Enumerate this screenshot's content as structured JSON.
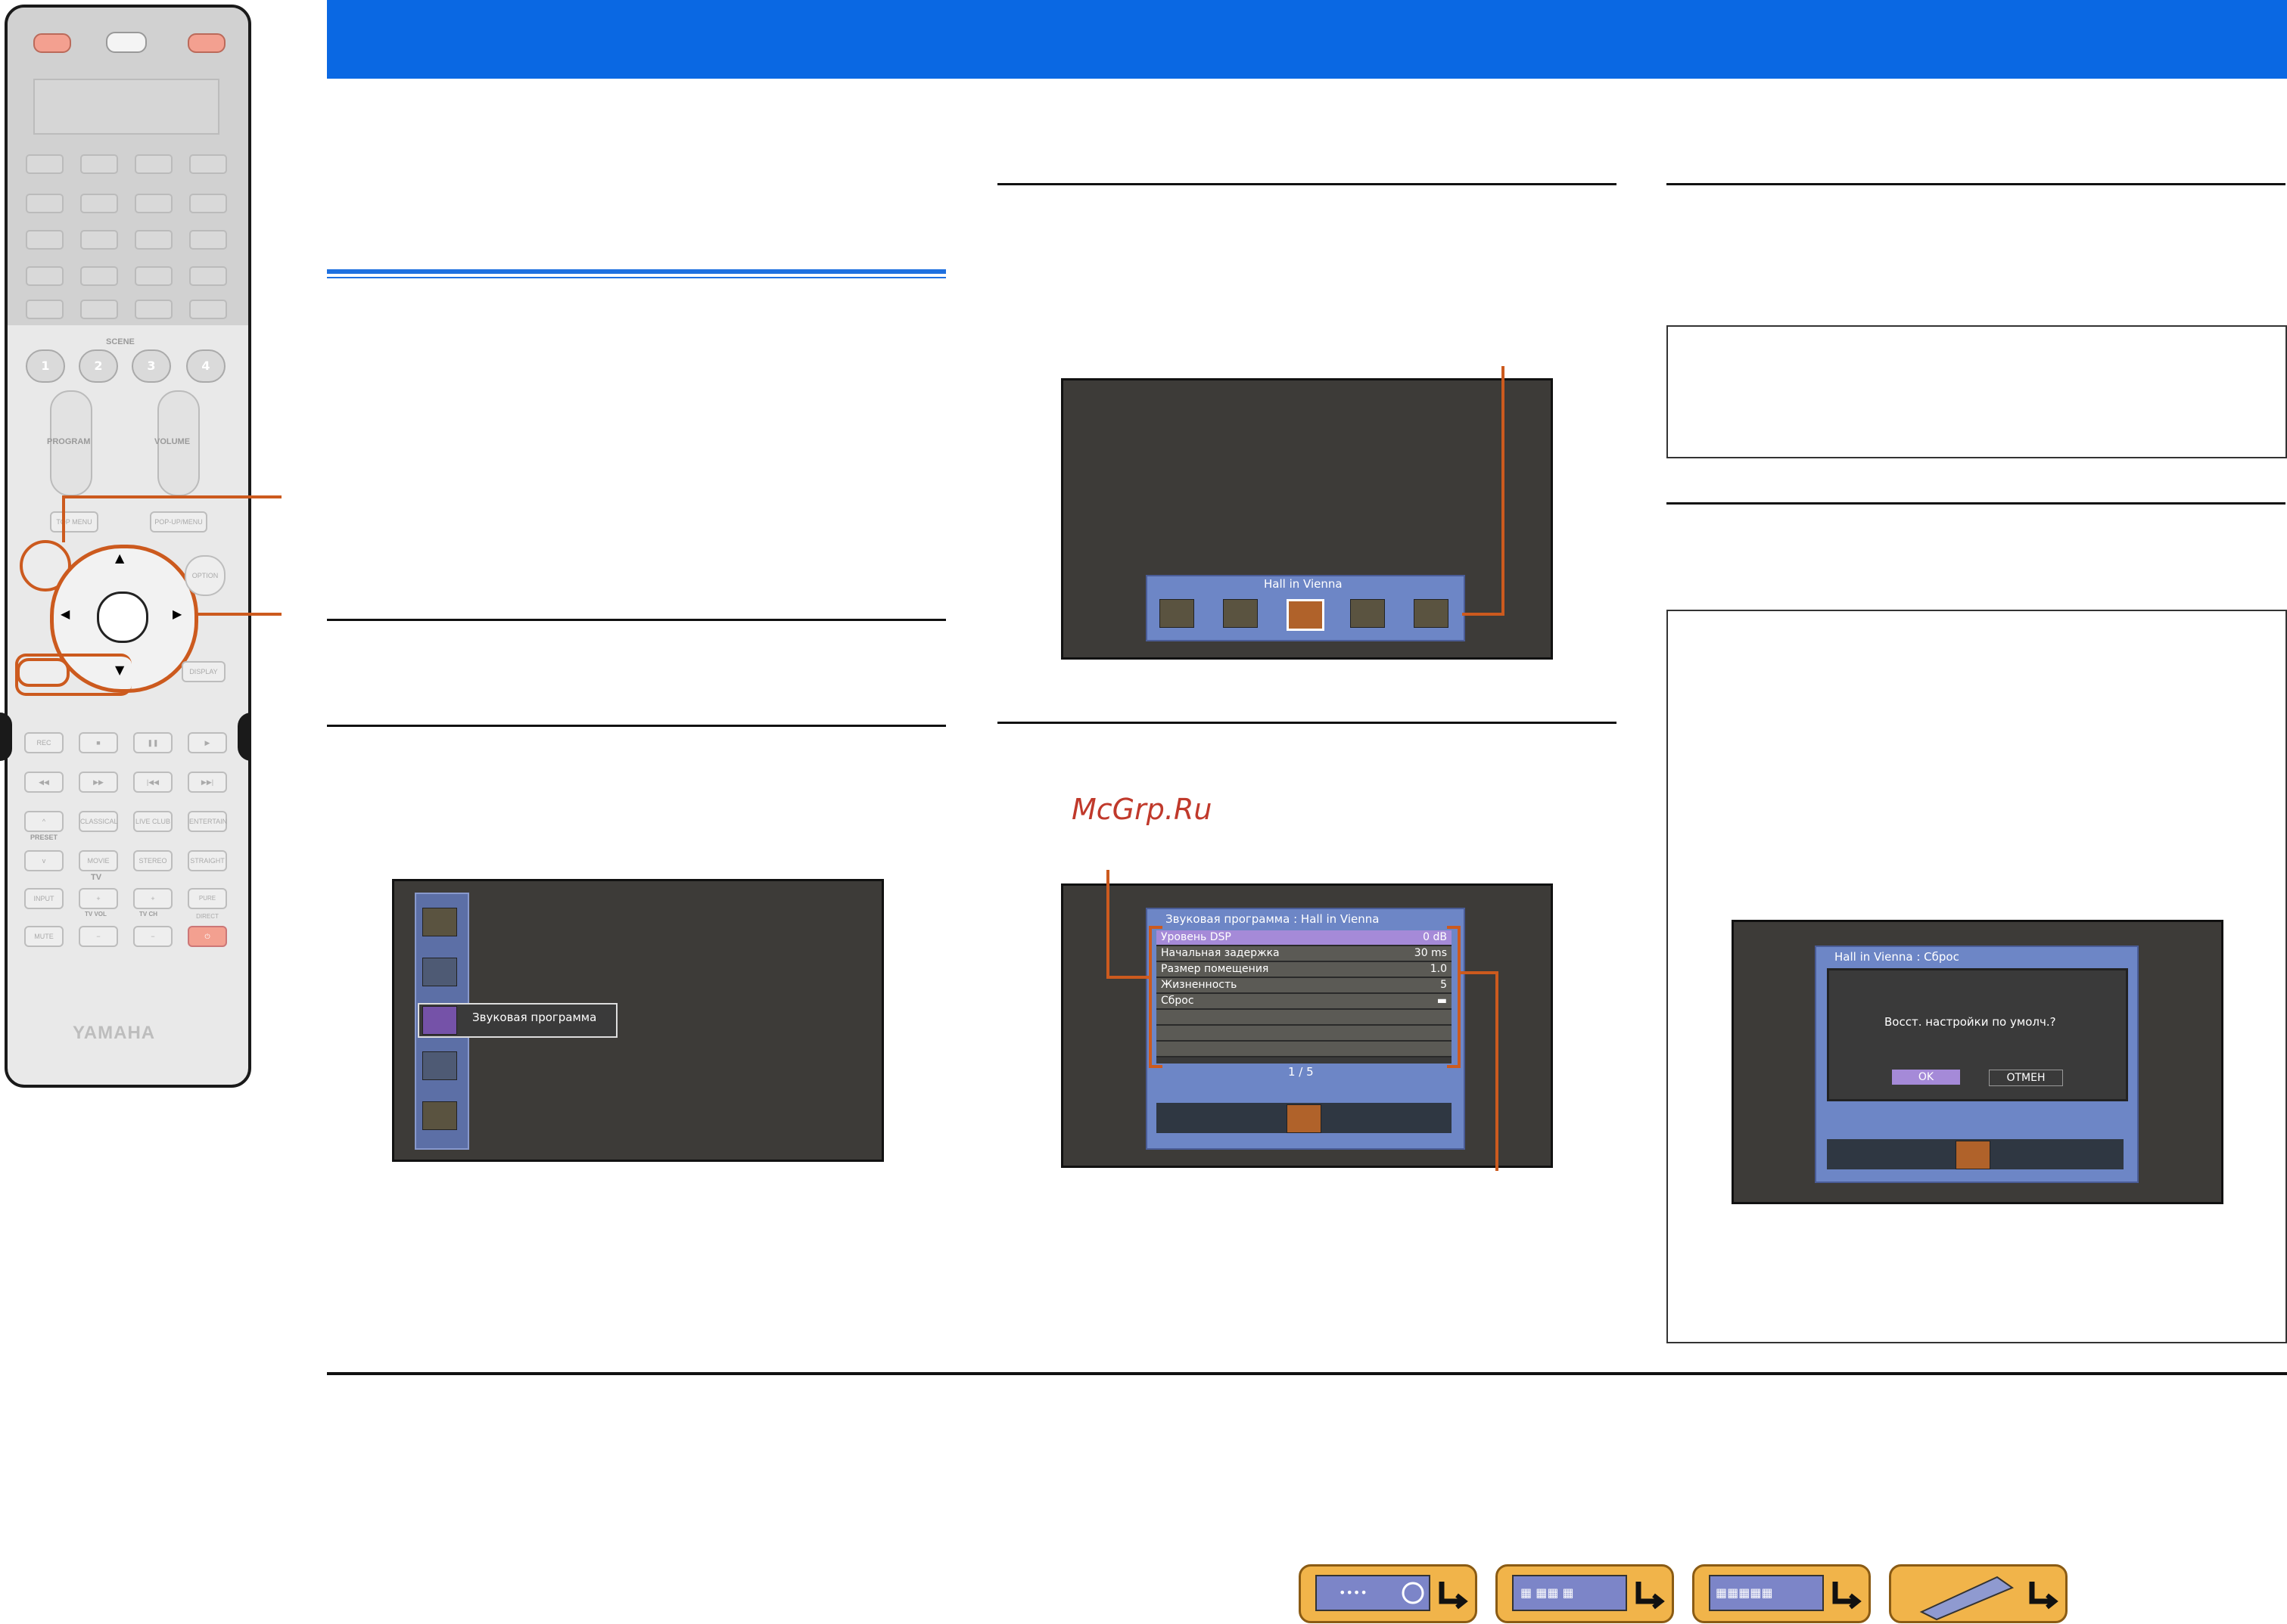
{
  "banner": {
    "color": "#0a68e3"
  },
  "remote": {
    "scene_label": "SCENE",
    "scene_buttons": [
      "1",
      "2",
      "3",
      "4"
    ],
    "program_label": "PROGRAM",
    "volume_label": "VOLUME",
    "top_menu": "TOP MENU",
    "popup_menu": "POP-UP/MENU",
    "option": "OPTION",
    "display": "DISPLAY",
    "rec": "REC",
    "preset": "PRESET",
    "classical": "CLASSICAL",
    "live_club": "LIVE CLUB",
    "entertain": "ENTERTAIN",
    "movie": "MOVIE",
    "stereo": "STEREO",
    "straight": "STRAIGHT",
    "tv_label": "TV",
    "input": "INPUT",
    "tv_vol": "TV VOL",
    "tv_ch": "TV CH",
    "pure_direct": "PURE DIRECT",
    "mute": "MUTE",
    "brand": "YAMAHA"
  },
  "screen1": {
    "menu_item_label": "Звуковая программа"
  },
  "screen2": {
    "program_name": "Hall in Vienna"
  },
  "watermark": "McGrp.Ru",
  "screen3": {
    "title": "Звуковая программа : Hall in Vienna",
    "rows": [
      {
        "label": "Уровень DSP",
        "value": "0 dB"
      },
      {
        "label": "Начальная задержка",
        "value": "30 ms"
      },
      {
        "label": "Размер помещения",
        "value": "1.0"
      },
      {
        "label": "Жизненность",
        "value": "5"
      },
      {
        "label": "Сброс",
        "value": ""
      }
    ],
    "page": "1 / 5"
  },
  "screen4": {
    "title": "Hall in Vienna : Сброс",
    "question": "Восст. настройки по умолч.?",
    "ok": "OK",
    "cancel": "ОТМЕН"
  },
  "nav_icons": [
    "front-panel-icon",
    "rear-panel-icon",
    "display-panel-icon",
    "remote-icon"
  ]
}
